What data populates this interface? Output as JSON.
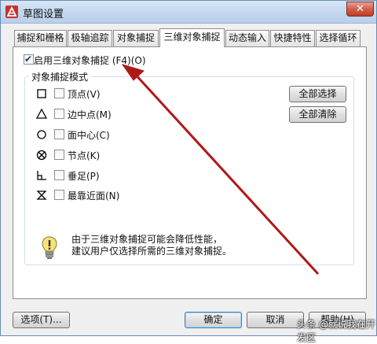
{
  "window": {
    "title": "草图设置"
  },
  "tabs": [
    {
      "label": "捕捉和栅格"
    },
    {
      "label": "极轴追踪"
    },
    {
      "label": "对象捕捉"
    },
    {
      "label": "三维对象捕捉"
    },
    {
      "label": "动态输入"
    },
    {
      "label": "快捷特性"
    },
    {
      "label": "选择循环"
    }
  ],
  "active_tab": "三维对象捕捉",
  "enable_3d_osnap": {
    "label": "启用三维对象捕捉 (F4)(O)",
    "checked": true
  },
  "group": {
    "title": "对象捕捉模式",
    "modes": [
      {
        "label": "顶点(V)",
        "symbol": "square-icon",
        "checked": false
      },
      {
        "label": "边中点(M)",
        "symbol": "triangle-icon",
        "checked": false
      },
      {
        "label": "面中心(C)",
        "symbol": "circle-icon",
        "checked": false
      },
      {
        "label": "节点(K)",
        "symbol": "node-icon",
        "checked": false
      },
      {
        "label": "垂足(P)",
        "symbol": "perpendicular-icon",
        "checked": false
      },
      {
        "label": "最靠近面(N)",
        "symbol": "nearest-icon",
        "checked": false
      }
    ],
    "select_all": "全部选择",
    "clear_all": "全部清除"
  },
  "info": {
    "line1": "由于三维对象捕捉可能会降低性能，",
    "line2": "建议用户仅选择所需的三维对象捕捉。"
  },
  "footer": {
    "options": "选项(T)...",
    "ok": "确定",
    "cancel": "取消",
    "help": "帮助(H)"
  },
  "watermark": "头条 @就说我在开发区",
  "colors": {
    "annotation_arrow": "#b01818",
    "titlebar": "#c3d7ef",
    "close_button": "#c8452d"
  }
}
